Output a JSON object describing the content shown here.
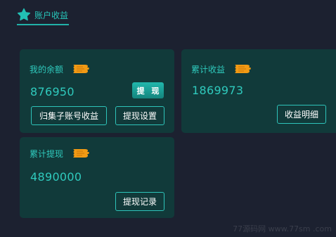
{
  "tab": {
    "label": "账户收益",
    "icon": "star-icon",
    "active": true
  },
  "accent_color": "#2fcabd",
  "card_bg": "#113a3a",
  "coin_color": "#f29a14",
  "balance_card": {
    "title": "我的余额",
    "value": "876950",
    "withdraw_label": "提 现",
    "aggregate_label": "归集子账号收益",
    "settings_label": "提现设置"
  },
  "earnings_card": {
    "title": "累计收益",
    "value": "1869973",
    "details_label": "收益明细"
  },
  "withdrawn_card": {
    "title": "累计提现",
    "value": "4890000",
    "records_label": "提现记录"
  },
  "watermark": "77源码网  www.77sm   .com"
}
